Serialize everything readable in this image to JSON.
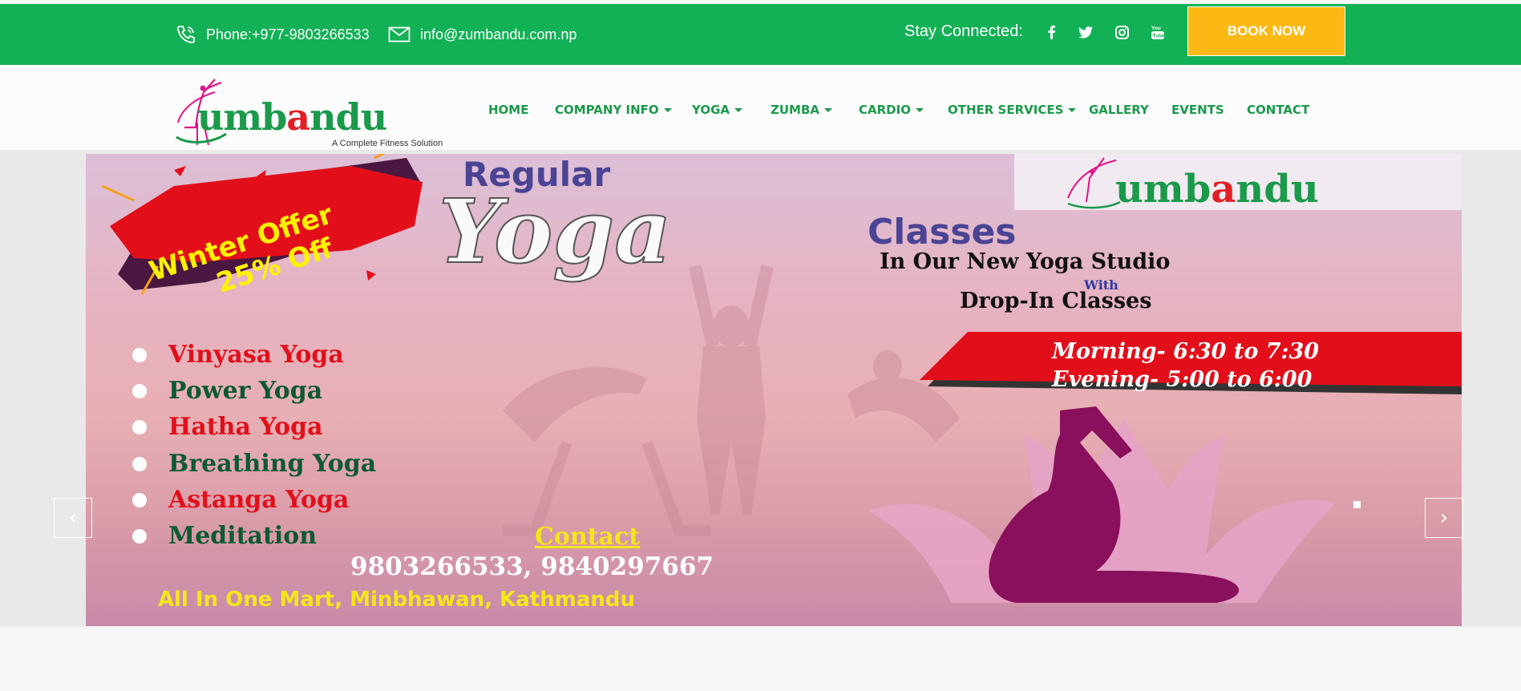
{
  "topbar": {
    "phone": "Phone:+977-9803266533",
    "email": "info@zumbandu.com.np",
    "stay_connected": "Stay Connected:",
    "social": [
      "facebook-icon",
      "twitter-icon",
      "instagram-icon",
      "youtube-icon"
    ],
    "book_now": "BOOK NOW",
    "bg_color": "#12b155",
    "button_color": "#fdb913"
  },
  "logo": {
    "text": "umbandu",
    "tagline": "A Complete Fitness Solution"
  },
  "nav": {
    "items": [
      {
        "label": "HOME",
        "dropdown": false
      },
      {
        "label": "COMPANY INFO",
        "dropdown": true
      },
      {
        "label": "YOGA",
        "dropdown": true
      },
      {
        "label": "ZUMBA",
        "dropdown": true
      },
      {
        "label": "CARDIO",
        "dropdown": true
      },
      {
        "label": "OTHER SERVICES",
        "dropdown": true
      },
      {
        "label": "GALLERY",
        "dropdown": false
      },
      {
        "label": "EVENTS",
        "dropdown": false
      },
      {
        "label": "CONTACT",
        "dropdown": false
      }
    ],
    "color": "#1a9a4a"
  },
  "banner": {
    "offer_line1": "Winter Offer",
    "offer_line2": "25% Off",
    "regular": "Regular",
    "yoga": "Yoga",
    "classes": "Classes",
    "studio": "In Our New Yoga Studio",
    "with": "With",
    "dropin": "Drop-In Classes",
    "logo_text": "umbandu",
    "morning": "Morning- 6:30 to 7:30",
    "evening": "Evening- 5:00 to 6:00",
    "list": [
      "Vinyasa Yoga",
      "Power Yoga",
      "Hatha Yoga",
      "Breathing Yoga",
      "Astanga Yoga",
      "Meditation"
    ],
    "contact": "Contact",
    "phones": "9803266533, 9840297667",
    "address": "All In One Mart, Minbhawan, Kathmandu"
  },
  "slider": {
    "prev": "‹",
    "next": "›"
  }
}
